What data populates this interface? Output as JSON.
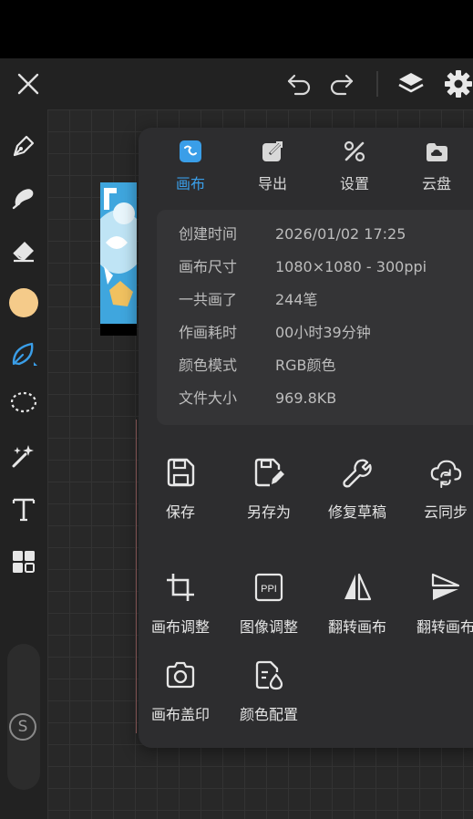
{
  "colors": {
    "accent": "#3a9ee8",
    "current_color": "#f5cb8a",
    "panel_bg": "#2d2d2f"
  },
  "topbar": {
    "close_icon": "close-icon",
    "undo_icon": "undo-icon",
    "redo_icon": "redo-icon",
    "layers_icon": "layers-icon",
    "settings_icon": "gear-icon"
  },
  "tools": [
    {
      "name": "pen-tool",
      "icon": "pen-icon"
    },
    {
      "name": "smudge-tool",
      "icon": "smudge-icon"
    },
    {
      "name": "eraser-tool",
      "icon": "eraser-icon"
    },
    {
      "name": "color-swatch",
      "icon": "color-swatch"
    },
    {
      "name": "leaf-brush-tool",
      "icon": "leaf-icon"
    },
    {
      "name": "lasso-tool",
      "icon": "lasso-icon"
    },
    {
      "name": "magic-wand-tool",
      "icon": "magic-wand-icon"
    },
    {
      "name": "text-tool",
      "icon": "text-icon"
    },
    {
      "name": "grid-tool",
      "icon": "grid-icon"
    }
  ],
  "size_button": "S",
  "tabs": [
    {
      "label": "画布",
      "icon": "canvas-icon",
      "active": true
    },
    {
      "label": "导出",
      "icon": "export-icon",
      "active": false
    },
    {
      "label": "设置",
      "icon": "tools-icon",
      "active": false
    },
    {
      "label": "云盘",
      "icon": "cloud-drive-icon",
      "active": false
    }
  ],
  "info": [
    {
      "key": "创建时间",
      "value": "2026/01/02 17:25"
    },
    {
      "key": "画布尺寸",
      "value": "1080×1080 - 300ppi"
    },
    {
      "key": "一共画了",
      "value": "244笔"
    },
    {
      "key": "作画耗时",
      "value": "00小时39分钟"
    },
    {
      "key": "颜色模式",
      "value": "RGB颜色"
    },
    {
      "key": "文件大小",
      "value": "969.8KB"
    }
  ],
  "actions": [
    {
      "label": "保存",
      "icon": "save-icon"
    },
    {
      "label": "另存为",
      "icon": "save-as-icon"
    },
    {
      "label": "修复草稿",
      "icon": "repair-icon"
    },
    {
      "label": "云同步",
      "icon": "cloud-sync-icon"
    },
    {
      "label": "画布调整",
      "icon": "crop-icon"
    },
    {
      "label": "图像调整",
      "icon": "ppi-icon",
      "badge": "PPI"
    },
    {
      "label": "翻转画布",
      "icon": "flip-horizontal-icon"
    },
    {
      "label": "翻转画布",
      "icon": "flip-vertical-icon"
    },
    {
      "label": "画布盖印",
      "icon": "camera-stamp-icon"
    },
    {
      "label": "颜色配置",
      "icon": "color-profile-icon"
    }
  ]
}
